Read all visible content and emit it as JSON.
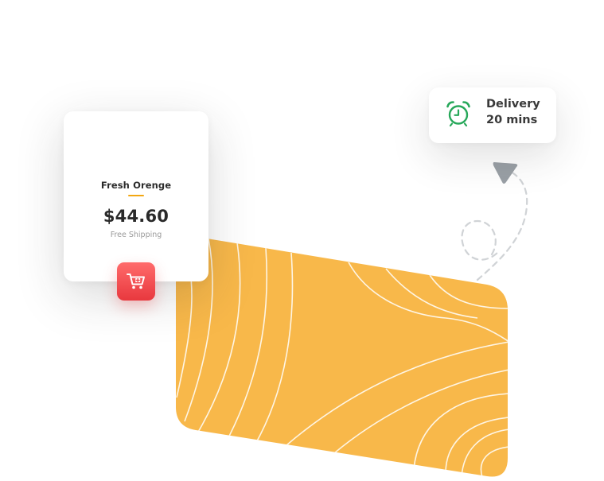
{
  "product": {
    "name": "Fresh Orenge",
    "price": "$44.60",
    "shipping": "Free Shipping",
    "cart_icon": "add-to-cart-icon"
  },
  "delivery": {
    "line1": "Delivery",
    "line2": "20 mins",
    "icon": "alarm-clock-icon"
  },
  "colors": {
    "slab": "#f8b84a",
    "accent_underline": "#f3a712",
    "cart_button": "#ef4a4f",
    "clock": "#27a85a",
    "arrow": "#9aa0a6"
  }
}
